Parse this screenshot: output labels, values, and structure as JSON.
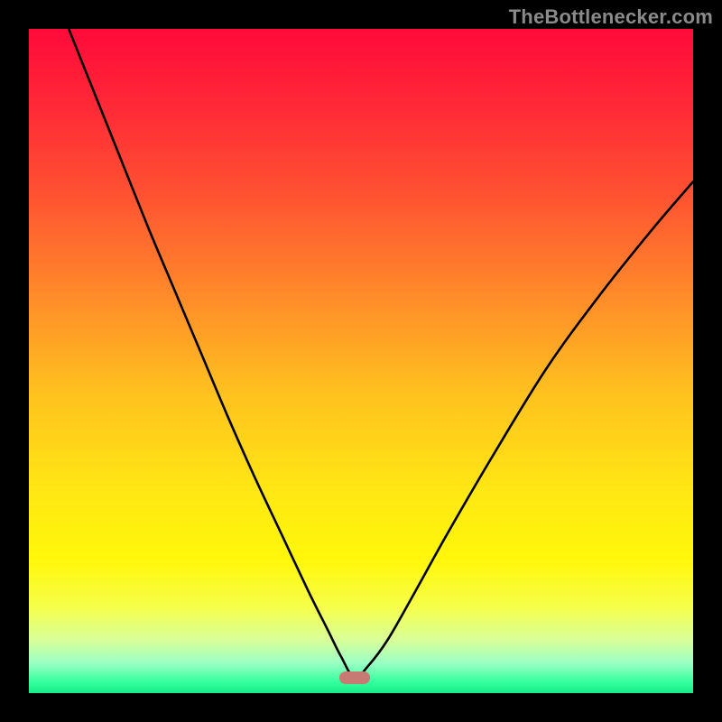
{
  "watermark": "TheBottlenecker.com",
  "colors": {
    "frame": "#000000",
    "watermark": "#8a8a8a",
    "curve_stroke": "#000000",
    "marker_fill": "#c77a74",
    "gradient_stops": [
      {
        "offset": 0.0,
        "color": "#ff0a3a"
      },
      {
        "offset": 0.12,
        "color": "#ff2a37"
      },
      {
        "offset": 0.25,
        "color": "#ff5231"
      },
      {
        "offset": 0.4,
        "color": "#ff8a2a"
      },
      {
        "offset": 0.55,
        "color": "#ffc21f"
      },
      {
        "offset": 0.7,
        "color": "#ffe813"
      },
      {
        "offset": 0.8,
        "color": "#fff70a"
      },
      {
        "offset": 0.87,
        "color": "#f6ff4a"
      },
      {
        "offset": 0.92,
        "color": "#d9ff9a"
      },
      {
        "offset": 0.955,
        "color": "#9affc4"
      },
      {
        "offset": 0.985,
        "color": "#2fff9b"
      },
      {
        "offset": 1.0,
        "color": "#18e98a"
      }
    ]
  },
  "chart_data": {
    "type": "line",
    "title": "",
    "xlabel": "",
    "ylabel": "",
    "xlim": [
      0,
      100
    ],
    "ylim": [
      0,
      100
    ],
    "grid": false,
    "legend": false,
    "notes": "V-shaped bottleneck curve. Y axis inverted visually (0 at bottom = best/green, 100 at top = worst/red). Minimum near x≈49 at y≈2.",
    "series": [
      {
        "name": "bottleneck-curve",
        "x": [
          6,
          10,
          14,
          18,
          22,
          26,
          30,
          34,
          38,
          42,
          45,
          47,
          49,
          51,
          54,
          58,
          63,
          70,
          78,
          86,
          94,
          100
        ],
        "y": [
          100,
          90,
          80,
          70,
          60.5,
          51,
          41.5,
          32.5,
          24,
          15.5,
          9.5,
          5.5,
          2.3,
          4,
          8,
          15,
          24,
          36,
          49,
          60,
          70,
          77
        ]
      }
    ],
    "marker": {
      "x": 49,
      "y": 2.3
    }
  }
}
